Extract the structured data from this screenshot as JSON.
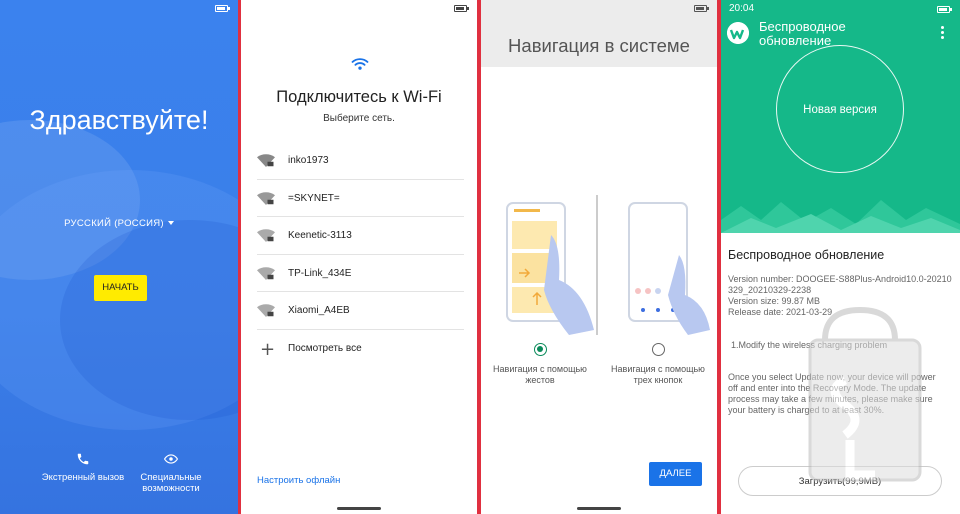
{
  "welcome": {
    "title": "Здравствуйте!",
    "language": "РУССКИЙ (РОССИЯ)",
    "start_label": "НАЧАТЬ",
    "emergency_label": "Экстренный вызов",
    "accessibility_label_1": "Специальные",
    "accessibility_label_2": "возможности"
  },
  "wifi": {
    "title": "Подключитесь к Wi-Fi",
    "subtitle": "Выберите сеть.",
    "networks": [
      {
        "name": "inko1973"
      },
      {
        "name": "=SKYNET="
      },
      {
        "name": "Keenetic-3113"
      },
      {
        "name": "TP-Link_434E"
      },
      {
        "name": "Xiaomi_A4EB"
      }
    ],
    "see_all": "Посмотреть все",
    "offline": "Настроить офлайн"
  },
  "navigation": {
    "title": "Навигация в системе",
    "option_gestures_1": "Навигация с помощью",
    "option_gestures_2": "жестов",
    "option_buttons_1": "Навигация с помощью",
    "option_buttons_2": "трех кнопок",
    "selected": "gestures",
    "next_label": "ДАЛЕЕ"
  },
  "update": {
    "time": "20:04",
    "app_title_1": "Беспроводное",
    "app_title_2": "обновление",
    "circle_text": "Новая версия",
    "section_title": "Беспроводное обновление",
    "version_number_1": "Version number: DOOGEE-S88Plus-Android10.0-20210",
    "version_number_2": "329_20210329-2238",
    "version_size": "Version size: 99.87 MB",
    "release_date": "Release date: 2021-03-29",
    "note": "1.Modify the wireless charging problem",
    "desc_1": "Once you select Update now, your device will power",
    "desc_2": "off and enter into the Recovery Mode. The update",
    "desc_3": "process may take a few minutes, please make sure",
    "desc_4": "your battery is charged to at least 30%.",
    "download_label": "Загрузить(99,9MB)",
    "accent": "#15b889"
  },
  "colors": {
    "welcome_bg": "#3b82ee",
    "start_button": "#ffeb00",
    "link_blue": "#1a73e8",
    "radio_selected": "#0a8a5a",
    "divider_red": "#e03040"
  }
}
